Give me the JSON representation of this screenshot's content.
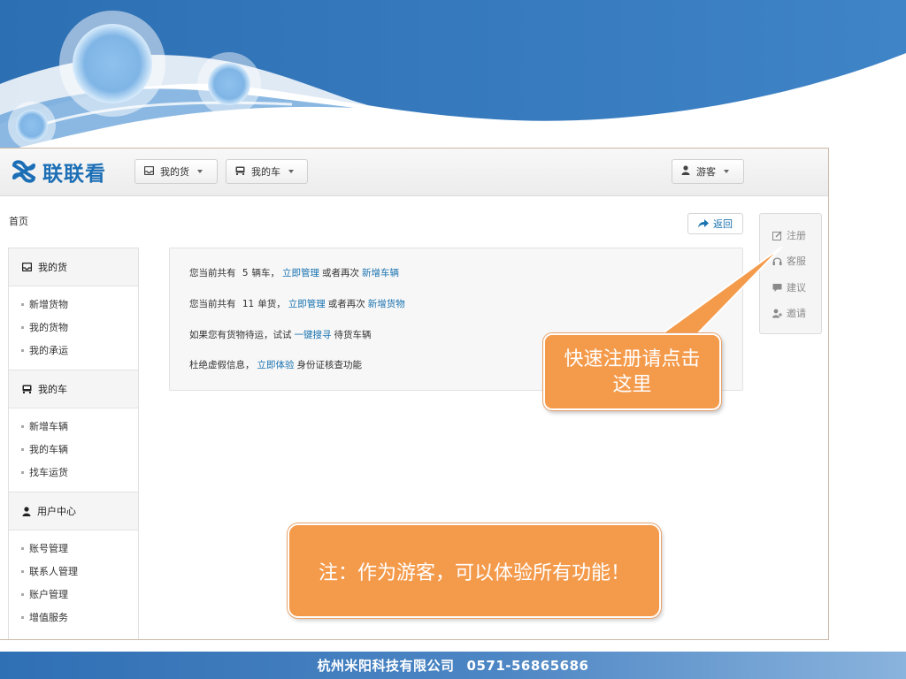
{
  "app": {
    "logo_text": "联联看"
  },
  "navbar": {
    "my_goods_label": "我的货",
    "my_car_label": "我的车",
    "guest_label": "游客"
  },
  "breadcrumb": "首页",
  "back_label": "返回",
  "sidebar": {
    "sections": [
      {
        "title": "我的货",
        "icon": "inbox-icon",
        "items": [
          "新增货物",
          "我的货物",
          "我的承运"
        ]
      },
      {
        "title": "我的车",
        "icon": "truck-icon",
        "items": [
          "新增车辆",
          "我的车辆",
          "找车运货"
        ]
      },
      {
        "title": "用户中心",
        "icon": "user-icon",
        "items": [
          "账号管理",
          "联系人管理",
          "账户管理",
          "增值服务"
        ]
      }
    ]
  },
  "info": {
    "line1": {
      "prefix": "您当前共有",
      "count": "5",
      "suffix": "辆车，",
      "link1": "立即管理",
      "middle": "或者再次",
      "link2": "新增车辆"
    },
    "line2": {
      "prefix": "您当前共有",
      "count": "11",
      "suffix": "单货，",
      "link1": "立即管理",
      "middle": "或者再次",
      "link2": "新增货物"
    },
    "line3": {
      "prefix": "如果您有货物待运，试试",
      "link1": "一键搜寻",
      "suffix": "待货车辆"
    },
    "line4": {
      "prefix": "杜绝虚假信息，",
      "link1": "立即体验",
      "suffix": "身份证核查功能"
    }
  },
  "float_bar": {
    "items": [
      {
        "label": "注册",
        "icon": "edit-icon"
      },
      {
        "label": "客服",
        "icon": "headset-icon"
      },
      {
        "label": "建议",
        "icon": "comment-icon"
      },
      {
        "label": "邀请",
        "icon": "user-add-icon"
      }
    ]
  },
  "callouts": {
    "register": "快速注册请点击这里",
    "guest": "注：作为游客，可以体验所有功能！"
  },
  "footer": {
    "company": "杭州米阳科技有限公司",
    "phone": "0571-56865686"
  },
  "colors": {
    "brand_blue": "#1c6fb6",
    "link_blue": "#1a73b0",
    "callout_orange": "#f49a4b",
    "header_blue": "#3e80c2"
  }
}
